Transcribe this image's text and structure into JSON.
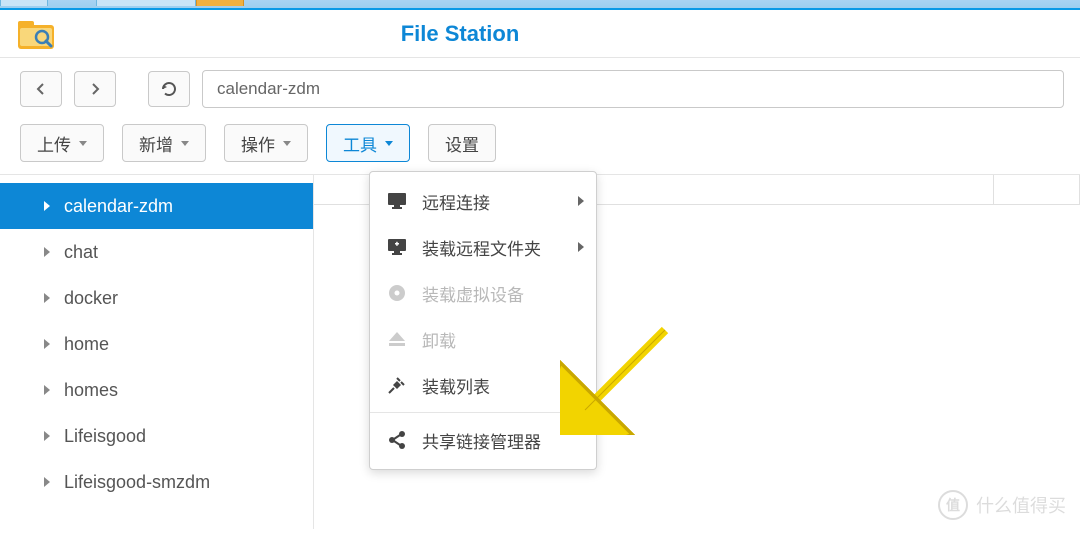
{
  "app_title": "File Station",
  "path": "calendar-zdm",
  "toolbar": {
    "upload": "上传",
    "create": "新增",
    "action": "操作",
    "tools": "工具",
    "settings": "设置"
  },
  "sidebar": {
    "items": [
      {
        "label": "calendar-zdm",
        "selected": true
      },
      {
        "label": "chat",
        "selected": false
      },
      {
        "label": "docker",
        "selected": false
      },
      {
        "label": "home",
        "selected": false
      },
      {
        "label": "homes",
        "selected": false
      },
      {
        "label": "Lifeisgood",
        "selected": false
      },
      {
        "label": "Lifeisgood-smzdm",
        "selected": false
      }
    ]
  },
  "tools_menu": {
    "remote_connect": "远程连接",
    "mount_remote": "装载远程文件夹",
    "mount_virtual": "装载虚拟设备",
    "unmount": "卸载",
    "mount_list": "装载列表",
    "share_manager": "共享链接管理器"
  },
  "watermark": {
    "icon": "值",
    "text": "什么值得买"
  }
}
